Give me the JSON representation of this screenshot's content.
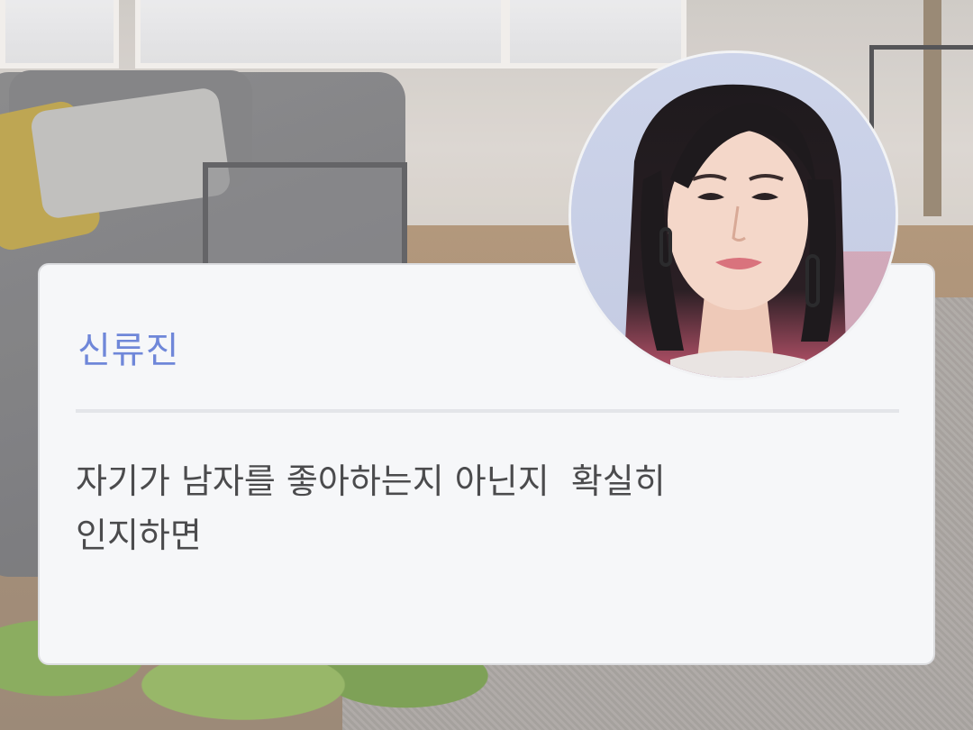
{
  "dialogue": {
    "speaker_name": "신류진",
    "message": "자기가 남자를 좋아하는지 아닌지  확실히\n인지하면"
  },
  "avatar": {
    "subject": "portrait-photo"
  },
  "colors": {
    "speaker_name": "#6f87d9",
    "message_text": "#4b4b4d",
    "card_background": "#f6f7f9",
    "divider": "#e3e5e9"
  }
}
